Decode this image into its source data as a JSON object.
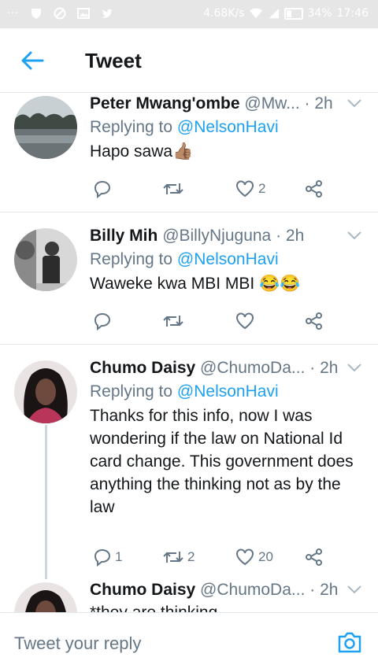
{
  "status_bar": {
    "speed": "4.68K/s",
    "battery": "34%",
    "time": "17:46"
  },
  "header": {
    "title": "Tweet"
  },
  "tweets": [
    {
      "name": "Peter Mwang'ombe",
      "handle": "@Mw...",
      "time": "· 2h",
      "reply_prefix": "Replying to ",
      "reply_to": "@NelsonHavi",
      "text": "Hapo sawa👍🏽",
      "reply_count": "",
      "retweet_count": "",
      "like_count": "2"
    },
    {
      "name": "Billy Mih",
      "handle": "@BillyNjuguna",
      "time": "· 2h",
      "reply_prefix": "Replying to ",
      "reply_to": "@NelsonHavi",
      "text": "Waweke kwa MBI MBI 😂😂",
      "reply_count": "",
      "retweet_count": "",
      "like_count": ""
    },
    {
      "name": "Chumo Daisy",
      "handle": "@ChumoDa...",
      "time": "· 2h",
      "reply_prefix": "Replying to ",
      "reply_to": "@NelsonHavi",
      "text": "Thanks for this info, now I was wondering if the law on National Id card  change. This government does anything the thinking not as by the law",
      "reply_count": "1",
      "retweet_count": "2",
      "like_count": "20"
    },
    {
      "name": "Chumo Daisy",
      "handle": "@ChumoDa...",
      "time": "· 2h",
      "text": "*they are thinking"
    }
  ],
  "reply_bar": {
    "placeholder": "Tweet your reply"
  },
  "colors": {
    "accent": "#1da1f2",
    "secondary_text": "#657786",
    "divider": "#e1e8ed"
  }
}
